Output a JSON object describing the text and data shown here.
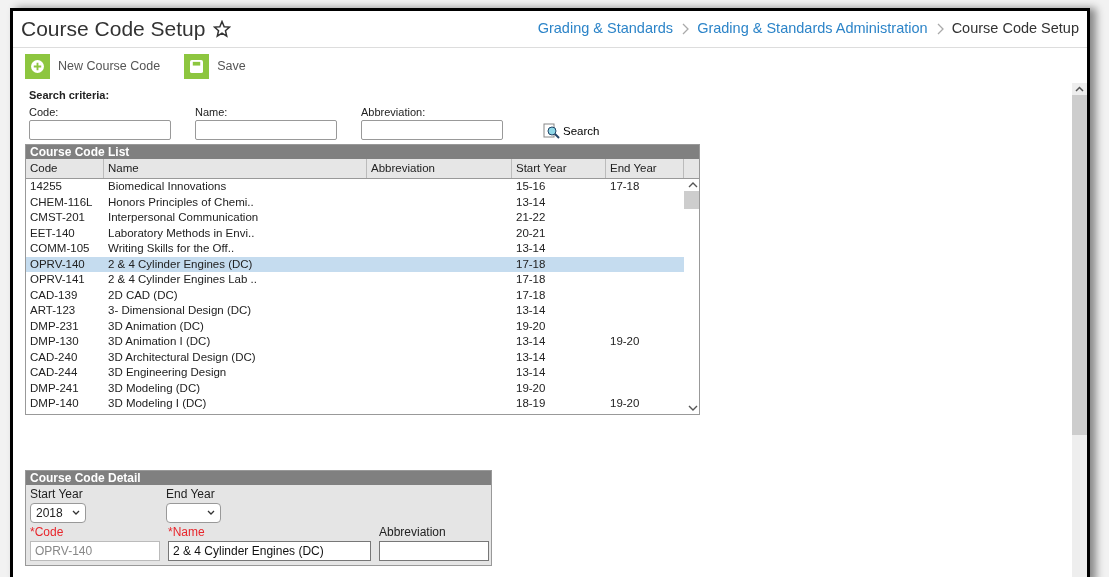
{
  "header": {
    "title": "Course Code Setup",
    "breadcrumbs": [
      {
        "label": "Grading & Standards",
        "kind": "link"
      },
      {
        "label": "Grading & Standards Administration",
        "kind": "link"
      },
      {
        "label": "Course Code Setup",
        "kind": "current"
      }
    ]
  },
  "toolbar": [
    {
      "label": "New Course Code",
      "kind": "add"
    },
    {
      "label": "Save",
      "kind": "save"
    }
  ],
  "search": {
    "title": "Search criteria:",
    "fields": [
      {
        "label": "Code:"
      },
      {
        "label": "Name:"
      },
      {
        "label": "Abbreviation:"
      }
    ],
    "button": "Search"
  },
  "list": {
    "title": "Course Code List",
    "columns": [
      "Code",
      "Name",
      "Abbreviation",
      "Start Year",
      "End Year"
    ],
    "rows": [
      {
        "cells": [
          "14255",
          "Biomedical Innovations",
          "",
          "15-16",
          "17-18"
        ],
        "selected": false
      },
      {
        "cells": [
          "CHEM-116L",
          "Honors Principles of Chemi..",
          "",
          "13-14",
          ""
        ],
        "selected": false
      },
      {
        "cells": [
          "CMST-201",
          "Interpersonal Communication",
          "",
          "21-22",
          ""
        ],
        "selected": false
      },
      {
        "cells": [
          "EET-140",
          "Laboratory Methods in Envi..",
          "",
          "20-21",
          ""
        ],
        "selected": false
      },
      {
        "cells": [
          "COMM-105",
          "Writing Skills for the Off..",
          "",
          "13-14",
          ""
        ],
        "selected": false
      },
      {
        "cells": [
          "OPRV-140",
          "2 & 4 Cylinder Engines (DC)",
          "",
          "17-18",
          ""
        ],
        "selected": true
      },
      {
        "cells": [
          "OPRV-141",
          "2 & 4 Cylinder Engines Lab ..",
          "",
          "17-18",
          ""
        ],
        "selected": false
      },
      {
        "cells": [
          "CAD-139",
          "2D CAD (DC)",
          "",
          "17-18",
          ""
        ],
        "selected": false
      },
      {
        "cells": [
          "ART-123",
          "3- Dimensional Design (DC)",
          "",
          "13-14",
          ""
        ],
        "selected": false
      },
      {
        "cells": [
          "DMP-231",
          "3D Animation (DC)",
          "",
          "19-20",
          ""
        ],
        "selected": false
      },
      {
        "cells": [
          "DMP-130",
          "3D Animation I (DC)",
          "",
          "13-14",
          "19-20"
        ],
        "selected": false
      },
      {
        "cells": [
          "CAD-240",
          "3D Architectural Design (DC)",
          "",
          "13-14",
          ""
        ],
        "selected": false
      },
      {
        "cells": [
          "CAD-244",
          "3D Engineering Design",
          "",
          "13-14",
          ""
        ],
        "selected": false
      },
      {
        "cells": [
          "DMP-241",
          "3D Modeling (DC)",
          "",
          "19-20",
          ""
        ],
        "selected": false
      },
      {
        "cells": [
          "DMP-140",
          "3D Modeling I (DC)",
          "",
          "18-19",
          "19-20"
        ],
        "selected": false
      }
    ]
  },
  "detail": {
    "title": "Course Code Detail",
    "selects": [
      {
        "label": "Start Year",
        "value": "2018"
      },
      {
        "label": "End Year"
      }
    ],
    "fields": [
      {
        "label": "*Code",
        "value": "OPRV-140",
        "required": true,
        "disabled": true
      },
      {
        "label": "*Name",
        "value": "2 & 4 Cylinder Engines (DC)",
        "required": true,
        "disabled": false
      },
      {
        "label": "Abbreviation",
        "required": false,
        "disabled": false
      }
    ]
  }
}
